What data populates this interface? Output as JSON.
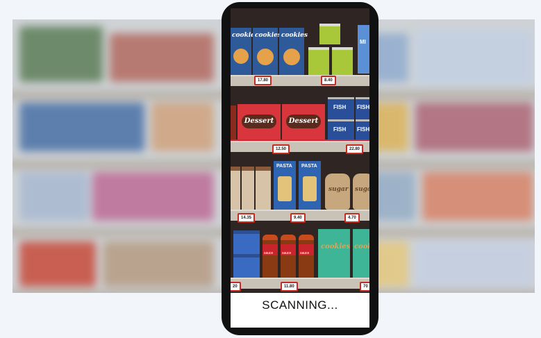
{
  "status": {
    "text": "SCANNING..."
  },
  "products": {
    "cookies_label": "cookies",
    "dessert_label": "Dessert",
    "fish_label": "FISH",
    "pasta_label": "PASTA",
    "sugar_label": "sugar",
    "milk_label": "MI",
    "sauce_label": "sauce"
  },
  "prices": {
    "shelf1_left": "17.80",
    "shelf1_right": "8.40",
    "shelf2_left": "12.50",
    "shelf2_right": "22.80",
    "shelf3_left": "14.35",
    "shelf3_mid": "9.40",
    "shelf3_right": "4.70",
    "shelf4_left": "20",
    "shelf4_mid": "11.80",
    "shelf4_right": "70"
  },
  "colors": {
    "accent_red": "#c62b20",
    "shelf_dark": "#2f2522",
    "phone_frame": "#111111"
  }
}
